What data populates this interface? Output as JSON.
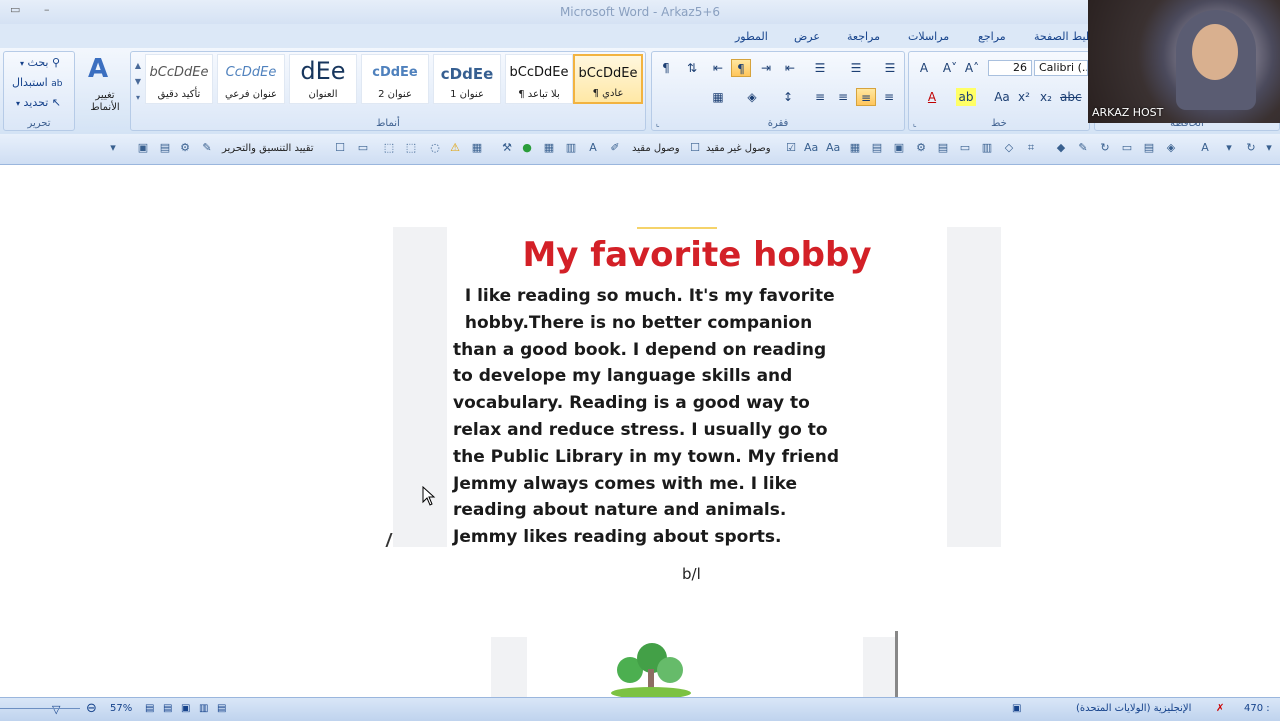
{
  "window": {
    "title": "Microsoft Word - Arkaz5+6"
  },
  "tabs": [
    "المطور",
    "عرض",
    "مراجعة",
    "مراسلات",
    "مراجع",
    "تخطيط الصفحة"
  ],
  "editing": {
    "find": "بحث",
    "replace": "استبدال",
    "select": "تحديد",
    "group": "تحرير"
  },
  "change_styles": {
    "line1": "تغيير",
    "line2": "الأنماط"
  },
  "styles": {
    "group": "أنماط",
    "items": [
      {
        "sample": "bCcDdEe",
        "name": "تأكيد دقيق"
      },
      {
        "sample": "CcDdEe",
        "name": "عنوان فرعي"
      },
      {
        "sample": "dEe",
        "name": "العنوان"
      },
      {
        "sample": "cDdEe",
        "name": "عنوان 2"
      },
      {
        "sample": "cDdEe",
        "name": "عنوان 1"
      },
      {
        "sample": "bCcDdEe",
        "name": "¶ بلا تباعد"
      },
      {
        "sample": "bCcDdEe",
        "name": "¶ عادي"
      }
    ]
  },
  "paragraph": {
    "group": "فقرة"
  },
  "font": {
    "group": "خط",
    "size": "26",
    "name": "Calibri (..."
  },
  "clipboard": {
    "group": "الحافظة"
  },
  "toolbar2": {
    "restrict": "تقييد التنسيق والتحرير",
    "unlimited_access": "وصول غير مقيد",
    "limited_access": "وصول مقيد"
  },
  "webcam": {
    "label": "ARKAZ HOST"
  },
  "document": {
    "hobby_title": "My favorite hobby",
    "hobby_body": "  I like reading so much. It's my favorite\n  hobby.There is no better companion\nthan a good book. I depend on reading\nto develope my language skills and\nvocabulary. Reading is a good way to\nrelax and reduce stress. I usually go to\nthe Public Library in my town. My friend\nJemmy always comes with me. I like\nreading about nature and animals.\nJemmy likes reading about sports.",
    "caption": "b/l"
  },
  "status": {
    "zoom": "57%",
    "language": "الإنجليزية (الولايات المتحدة)",
    "words": "470 :"
  },
  "colors": {
    "accent": "#15428b",
    "title_red": "#d32027",
    "selected_style": "#f2b340"
  }
}
